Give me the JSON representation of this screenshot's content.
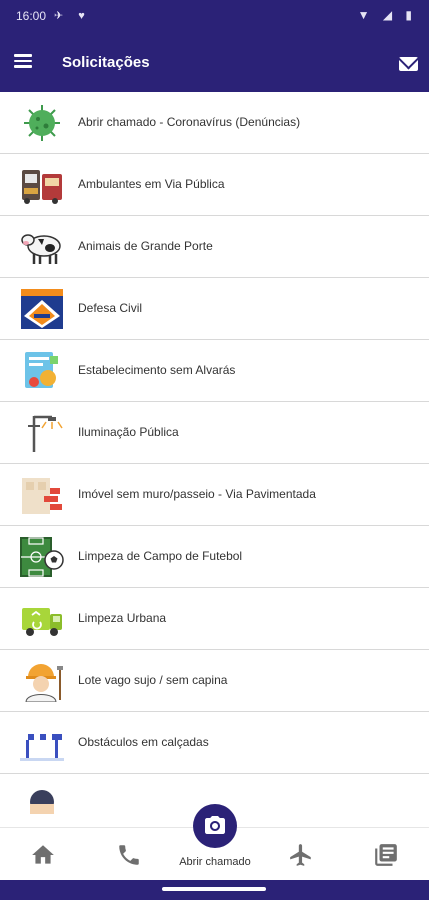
{
  "status_bar": {
    "time": "16:00",
    "left_icons": "✈ ♥",
    "right_icons": "▼ ◢ ▮"
  },
  "app_bar": {
    "title": "Solicitações",
    "menu_icon": "menu-icon",
    "mail_icon": "mail-icon"
  },
  "list": {
    "items": [
      {
        "label": "Abrir chamado - Coronavírus (Denúncias)",
        "icon": "coronavirus-icon"
      },
      {
        "label": "Ambulantes em Via Pública",
        "icon": "street-vendors-icon"
      },
      {
        "label": "Animais de Grande Porte",
        "icon": "cow-icon"
      },
      {
        "label": "Defesa Civil",
        "icon": "civil-defense-icon"
      },
      {
        "label": "Estabelecimento sem Alvarás",
        "icon": "license-document-icon"
      },
      {
        "label": "Iluminação Pública",
        "icon": "street-lamp-icon"
      },
      {
        "label": "Imóvel sem muro/passeio - Via Pavimentada",
        "icon": "building-wall-icon"
      },
      {
        "label": "Limpeza de Campo de Futebol",
        "icon": "soccer-field-icon"
      },
      {
        "label": "Limpeza Urbana",
        "icon": "garbage-truck-icon"
      },
      {
        "label": "Lote vago sujo / sem capina",
        "icon": "worker-icon"
      },
      {
        "label": "Obstáculos em calçadas",
        "icon": "sidewalk-barrier-icon"
      },
      {
        "label": "",
        "icon": "person-icon"
      }
    ]
  },
  "bottom_nav": {
    "home": "home-icon",
    "phone": "phone-icon",
    "center_label": "Abrir chamado",
    "center_icon": "camera-icon",
    "airplane": "airplane-icon",
    "news": "news-icon"
  },
  "colors": {
    "primary": "#2b2277",
    "icon_gray": "#6f6f6f",
    "divider": "#d8d8d8"
  }
}
